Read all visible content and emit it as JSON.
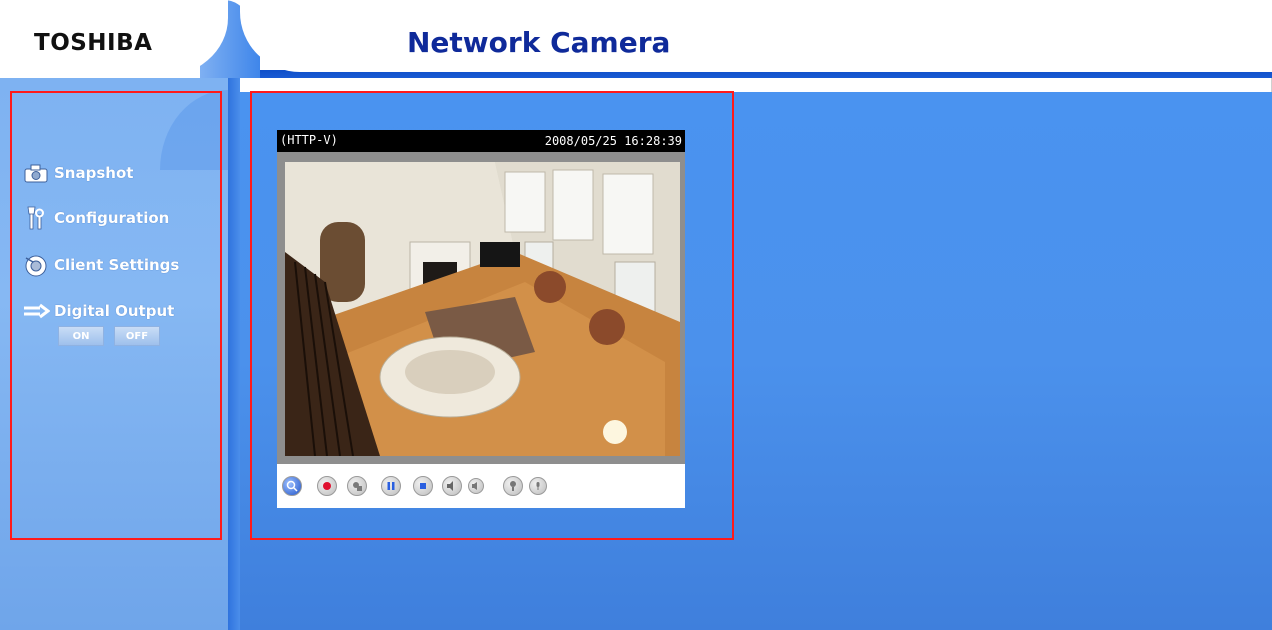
{
  "header": {
    "logo_text": "TOSHIBA",
    "title": "Network Camera"
  },
  "sidebar": {
    "items": [
      {
        "label": "Snapshot",
        "icon": "camera-icon"
      },
      {
        "label": "Configuration",
        "icon": "tools-icon"
      },
      {
        "label": "Client Settings",
        "icon": "client-settings-icon"
      },
      {
        "label": "Digital Output",
        "icon": "digital-output-icon"
      }
    ],
    "digital_output_buttons": {
      "on_label": "ON",
      "off_label": "OFF"
    }
  },
  "viewer": {
    "protocol": "(HTTP-V)",
    "timestamp": "2008/05/25 16:28:39",
    "controls": [
      "zoom-icon",
      "record-icon",
      "snapshot-icon",
      "pause-icon",
      "stop-icon",
      "speaker-icon",
      "mute-icon",
      "talk-icon",
      "mic-icon"
    ]
  },
  "colors": {
    "highlight_box": "#ff1a1a",
    "title": "#0f2a9a",
    "header_band": "#0f4fc9",
    "main_bg": "#4a93f0",
    "sidebar_bg": "#7eb2f2"
  }
}
